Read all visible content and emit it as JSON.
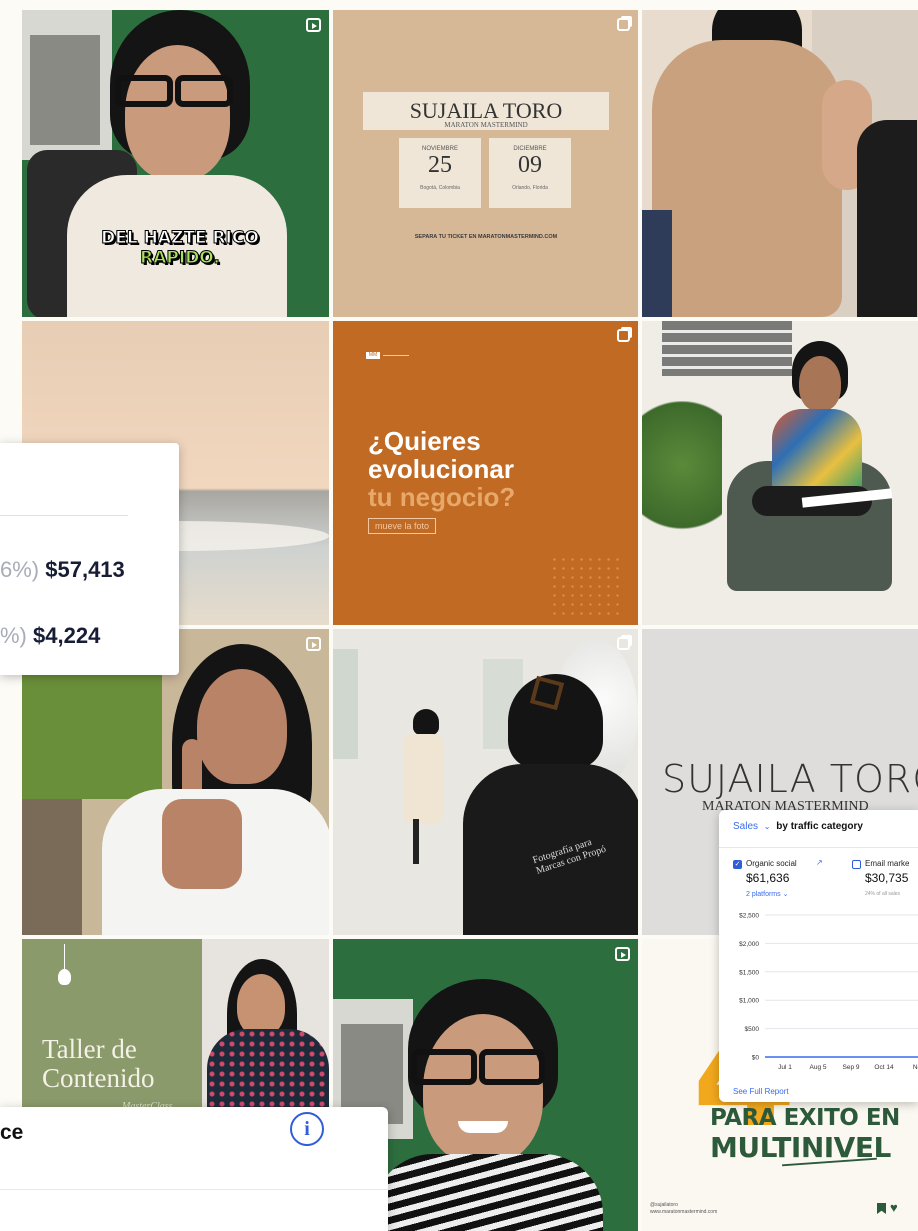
{
  "reel1": {
    "caption_line1": "DEL HAZTE RICO",
    "caption_line2": "RAPIDO."
  },
  "event_post": {
    "title": "SUJAILA TORO",
    "subtitle": "MARATON MASTERMIND",
    "date1": {
      "month": "NOVIEMBRE",
      "day": "25",
      "place": "Bogotá, Colombia"
    },
    "date2": {
      "month": "DICIEMBRE",
      "day": "09",
      "place": "Orlando, Florida"
    },
    "footer": "SEPARA TU TICKET EN MARATONMASTERMIND.COM"
  },
  "promo_post": {
    "brand_tag": "MM",
    "line1": "¿Quieres",
    "line2": "evolucionar",
    "line3": "tu negocio?",
    "cta": "mueve la foto"
  },
  "studio_post": {
    "shirt_text_line1": "Fotografía para",
    "shirt_text_line2": "Marcas con Propó"
  },
  "title_post": {
    "title": "SUJAILA TORO",
    "subtitle": "MARATON MASTERMIND"
  },
  "workshop_post": {
    "line1": "Taller de",
    "line2": "Contenido",
    "signature": "MasterClass"
  },
  "mlm_post": {
    "line1": "PARA EXITO EN",
    "line2": "MULTINIVEL",
    "big_number": "4",
    "handle": "@sujailatoro",
    "site": "www.maratonmastermind.com"
  },
  "stats_card": {
    "row1_pct": "6%)",
    "row1_value": "$57,413",
    "row2_pct": "%)",
    "row2_value": "$4,224"
  },
  "sales_card": {
    "title": "Sales",
    "subtitle": "by traffic category",
    "cat1": {
      "label": "Organic social",
      "value": "$61,636",
      "link": "2 platforms"
    },
    "cat2": {
      "label": "Email marke",
      "value": "$30,735",
      "note": "24% of all sales"
    },
    "footer_link": "See Full Report",
    "chart_data": {
      "type": "line",
      "title": "",
      "xlabel": "",
      "ylabel": "",
      "x": [
        "Jul 1",
        "Aug 5",
        "Sep 9",
        "Oct 14",
        "No"
      ],
      "y_ticks": [
        "$2,500",
        "$2,000",
        "$1,500",
        "$1,000",
        "$500",
        "$0"
      ],
      "ylim": [
        0,
        2500
      ],
      "series": [
        {
          "values": [
            0,
            0,
            0,
            0,
            0
          ]
        }
      ],
      "grid": true
    }
  },
  "bottom_card": {
    "title_fragment": "ce",
    "info_icon": "info-icon"
  }
}
